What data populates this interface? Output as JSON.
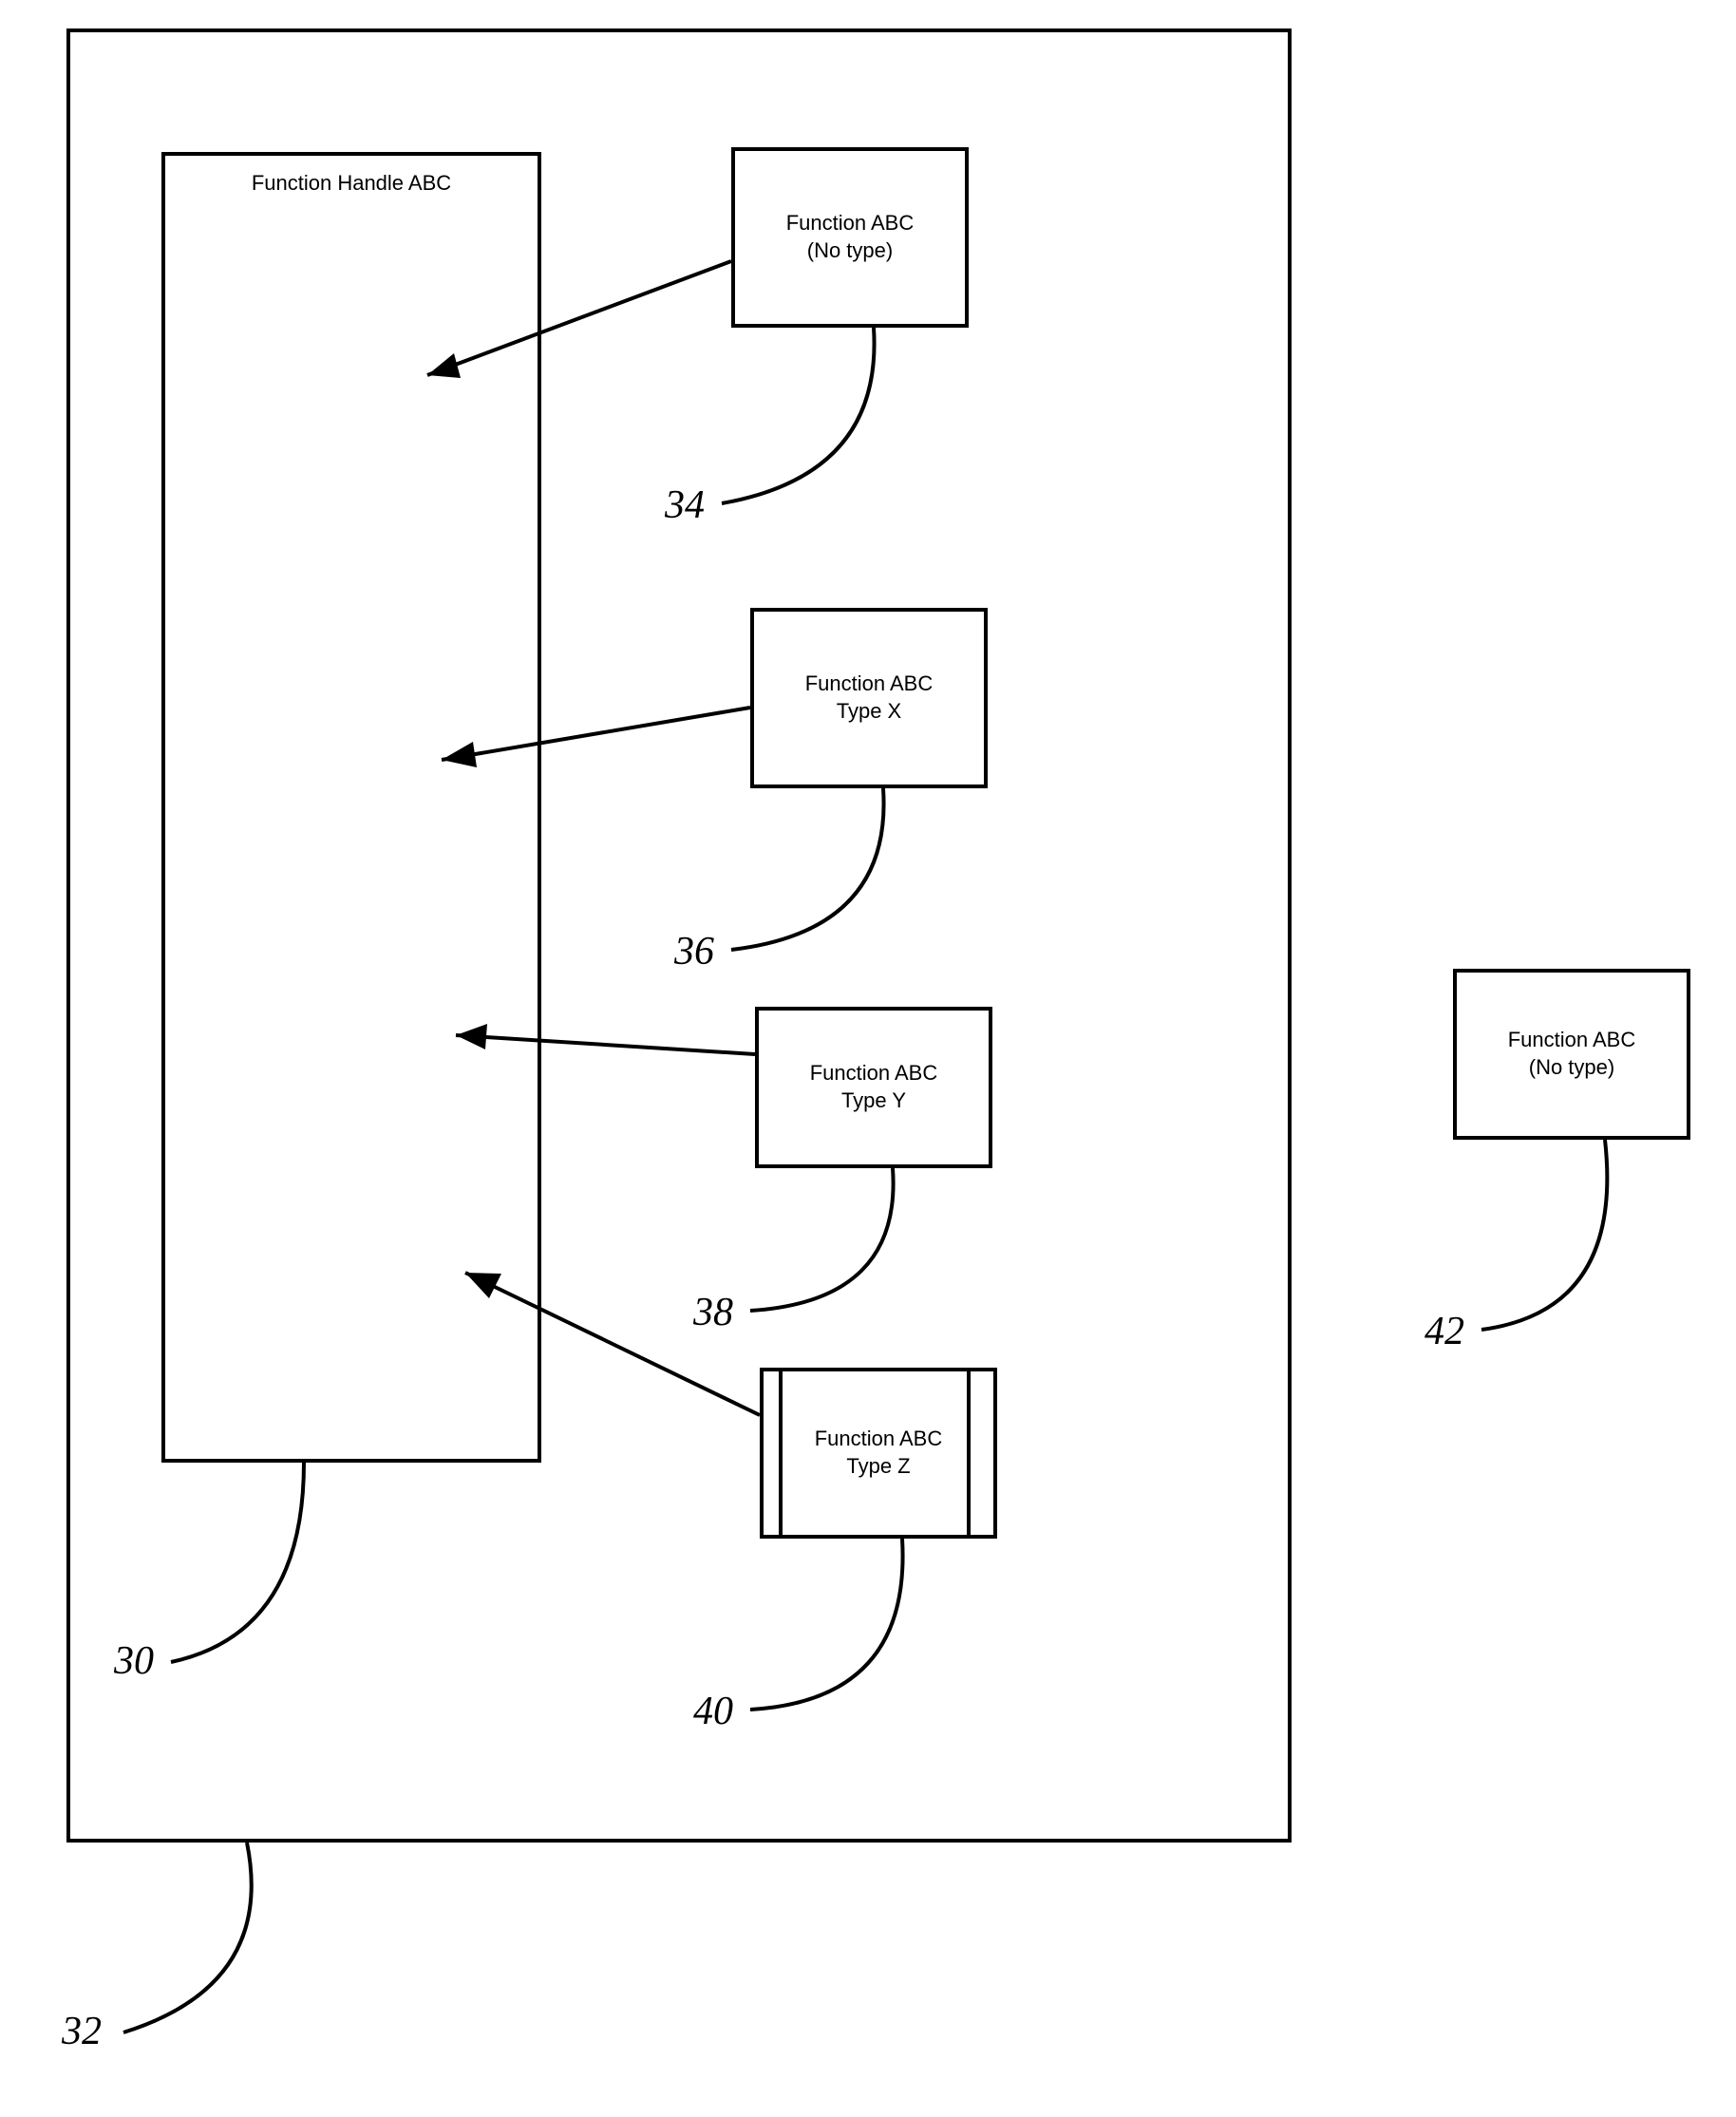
{
  "handle": {
    "title": "Function Handle ABC"
  },
  "functions": {
    "f34": {
      "line1": "Function  ABC",
      "line2": "(No type)"
    },
    "f36": {
      "line1": "Function ABC",
      "line2": "Type X"
    },
    "f38": {
      "line1": "Function ABC",
      "line2": "Type Y"
    },
    "f40": {
      "line1": "Function ABC",
      "line2": "Type Z"
    },
    "f42": {
      "line1": "Function  ABC",
      "line2": "(No type)"
    }
  },
  "refs": {
    "r30": "30",
    "r32": "32",
    "r34": "34",
    "r36": "36",
    "r38": "38",
    "r40": "40",
    "r42": "42"
  }
}
